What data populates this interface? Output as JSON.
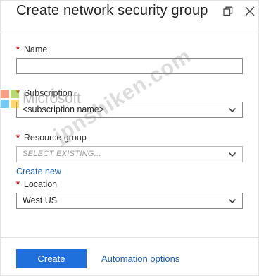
{
  "window": {
    "title": "Create network security group"
  },
  "form": {
    "name": {
      "label": "Name",
      "value": ""
    },
    "subscription": {
      "label": "Subscription",
      "value": "<subscription name>"
    },
    "resource_group": {
      "label": "Resource group",
      "value": "SELECT EXISTING...",
      "create_new_link": "Create new"
    },
    "location": {
      "label": "Location",
      "value": "West US"
    },
    "required_marker": "*"
  },
  "footer": {
    "create_label": "Create",
    "automation_label": "Automation options"
  },
  "watermark": {
    "logo_text": "Microsoft",
    "site_text": "jpnshiken.com"
  },
  "colors": {
    "primary_button": "#1f6fdc",
    "link": "#1a5fb4",
    "required": "#c50f1f"
  }
}
